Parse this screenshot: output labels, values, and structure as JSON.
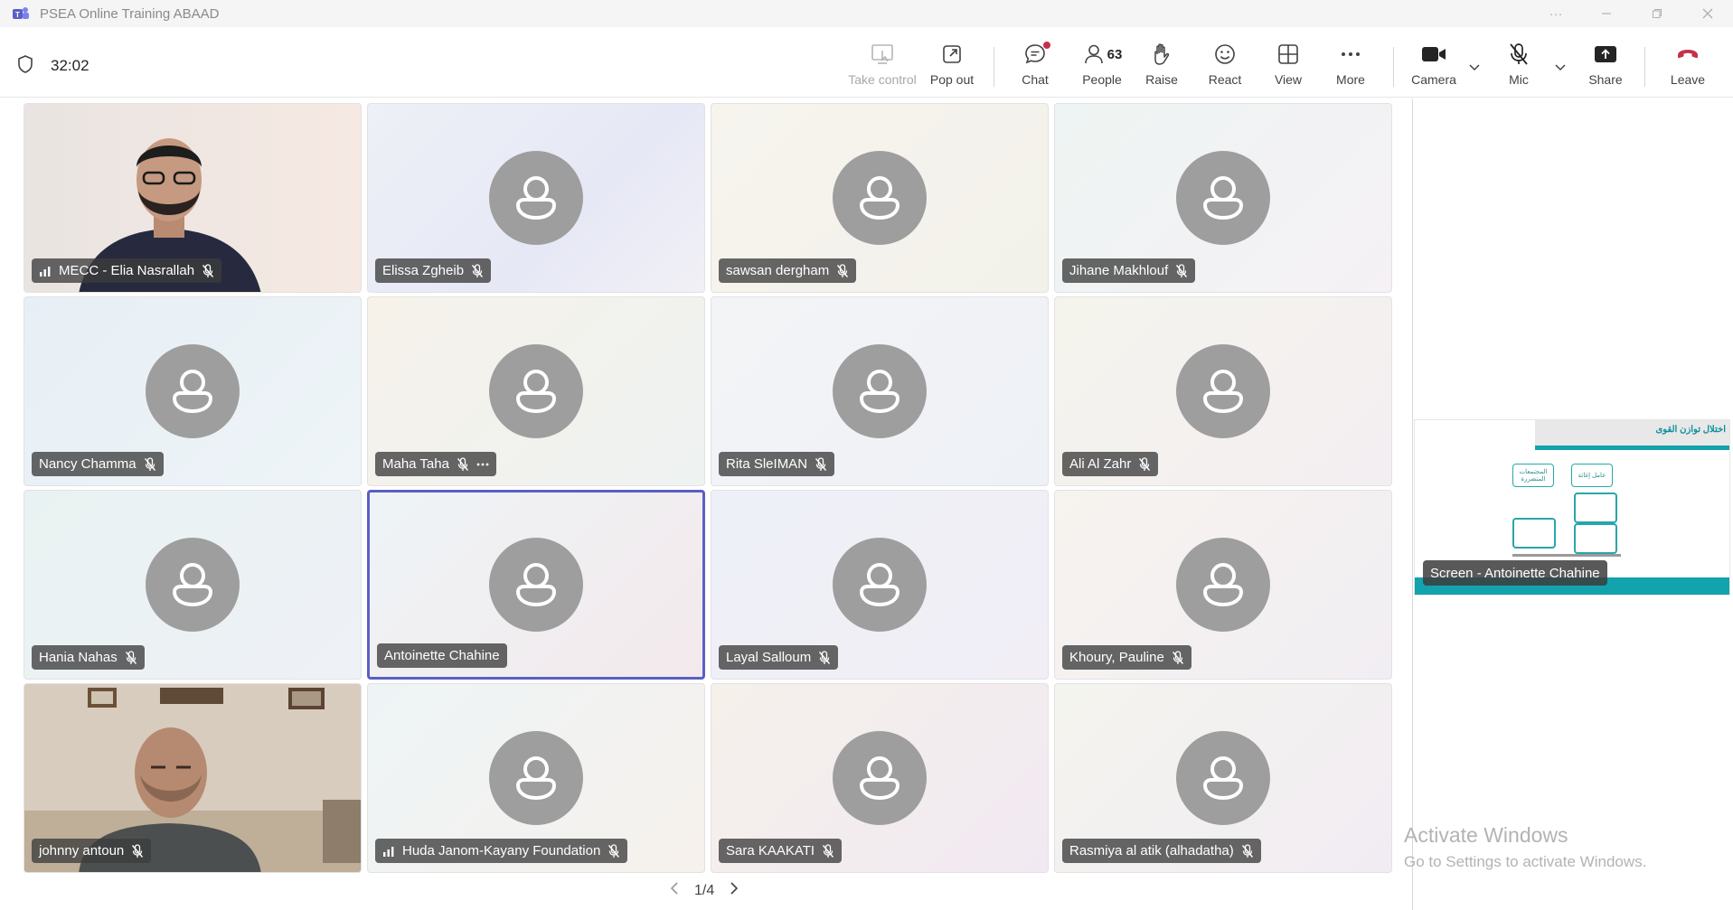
{
  "window": {
    "title": "PSEA Online Training ABAAD"
  },
  "toolbar": {
    "timer": "32:02",
    "buttons": {
      "take_control": "Take control",
      "pop_out": "Pop out",
      "chat": "Chat",
      "people": "People",
      "people_count": "63",
      "raise": "Raise",
      "react": "React",
      "view": "View",
      "more": "More",
      "camera": "Camera",
      "mic": "Mic",
      "share": "Share",
      "leave": "Leave"
    }
  },
  "colors": {
    "accent": "#5b5fc7",
    "leave": "#c4314b",
    "slide_teal": "#12a3ad"
  },
  "participants": [
    {
      "name": "MECC - Elia Nasrallah",
      "muted": true,
      "video": true,
      "signal": true
    },
    {
      "name": "Elissa Zgheib",
      "muted": true
    },
    {
      "name": "sawsan dergham",
      "muted": true
    },
    {
      "name": "Jihane Makhlouf",
      "muted": true
    },
    {
      "name": "Nancy Chamma",
      "muted": true
    },
    {
      "name": "Maha Taha",
      "muted": true,
      "more": true
    },
    {
      "name": "Rita SleIMAN",
      "muted": true
    },
    {
      "name": "Ali Al Zahr",
      "muted": true
    },
    {
      "name": "Hania Nahas",
      "muted": true
    },
    {
      "name": "Antoinette Chahine",
      "muted": false,
      "active_speaker": true
    },
    {
      "name": "Layal Salloum",
      "muted": true
    },
    {
      "name": "Khoury, Pauline",
      "muted": true
    },
    {
      "name": "johnny antoun",
      "muted": true,
      "video": true
    },
    {
      "name": "Huda Janom-Kayany Foundation",
      "muted": true,
      "signal": true
    },
    {
      "name": "Sara KAAKATI",
      "muted": true
    },
    {
      "name": "Rasmiya al atik (alhadatha)",
      "muted": true
    }
  ],
  "pager": {
    "label": "1/4"
  },
  "screen_share": {
    "label": "Screen - Antoinette Chahine",
    "slide_title": "اختلال توازن القوى",
    "box1": "المجتمعات المتضررة",
    "box2": "عامل إغاثة"
  },
  "watermark": {
    "line1": "Activate Windows",
    "line2": "Go to Settings to activate Windows."
  }
}
